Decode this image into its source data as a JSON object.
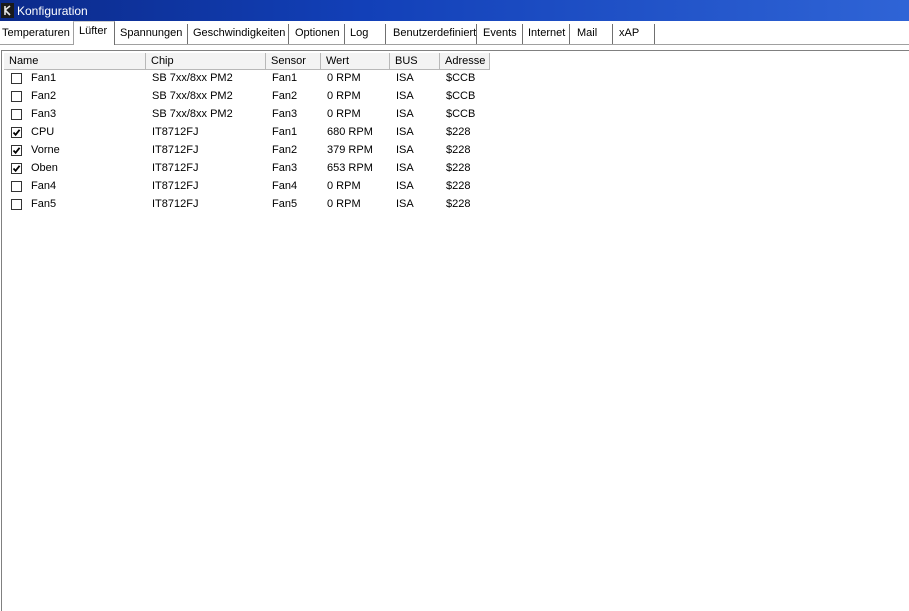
{
  "window": {
    "title": "Konfiguration"
  },
  "tabs": [
    {
      "label": "Temperaturen",
      "active": false
    },
    {
      "label": "Lüfter",
      "active": true
    },
    {
      "label": "Spannungen",
      "active": false
    },
    {
      "label": "Geschwindigkeiten",
      "active": false
    },
    {
      "label": "Optionen",
      "active": false
    },
    {
      "label": "Log",
      "active": false
    },
    {
      "label": "Benutzerdefiniert",
      "active": false
    },
    {
      "label": "Events",
      "active": false
    },
    {
      "label": "Internet",
      "active": false
    },
    {
      "label": "Mail",
      "active": false
    },
    {
      "label": "xAP",
      "active": false
    }
  ],
  "table": {
    "columns": [
      "Name",
      "Chip",
      "Sensor",
      "Wert",
      "BUS",
      "Adresse"
    ],
    "rows": [
      {
        "checked": false,
        "name": "Fan1",
        "chip": "SB 7xx/8xx PM2",
        "sensor": "Fan1",
        "wert": "0 RPM",
        "bus": "ISA",
        "adresse": "$CCB"
      },
      {
        "checked": false,
        "name": "Fan2",
        "chip": "SB 7xx/8xx PM2",
        "sensor": "Fan2",
        "wert": "0 RPM",
        "bus": "ISA",
        "adresse": "$CCB"
      },
      {
        "checked": false,
        "name": "Fan3",
        "chip": "SB 7xx/8xx PM2",
        "sensor": "Fan3",
        "wert": "0 RPM",
        "bus": "ISA",
        "adresse": "$CCB"
      },
      {
        "checked": true,
        "name": "CPU",
        "chip": "IT8712FJ",
        "sensor": "Fan1",
        "wert": "680 RPM",
        "bus": "ISA",
        "adresse": "$228"
      },
      {
        "checked": true,
        "name": "Vorne",
        "chip": "IT8712FJ",
        "sensor": "Fan2",
        "wert": "379 RPM",
        "bus": "ISA",
        "adresse": "$228"
      },
      {
        "checked": true,
        "name": "Oben",
        "chip": "IT8712FJ",
        "sensor": "Fan3",
        "wert": "653 RPM",
        "bus": "ISA",
        "adresse": "$228"
      },
      {
        "checked": false,
        "name": "Fan4",
        "chip": "IT8712FJ",
        "sensor": "Fan4",
        "wert": "0 RPM",
        "bus": "ISA",
        "adresse": "$228"
      },
      {
        "checked": false,
        "name": "Fan5",
        "chip": "IT8712FJ",
        "sensor": "Fan5",
        "wert": "0 RPM",
        "bus": "ISA",
        "adresse": "$228"
      }
    ]
  },
  "icons": {
    "app": "app-icon",
    "checkbox_checked": "checkmark-icon"
  },
  "colors": {
    "titlebar_start": "#0b2a8a",
    "titlebar_end": "#2f64d6",
    "header_bg": "#f3f3f3"
  }
}
